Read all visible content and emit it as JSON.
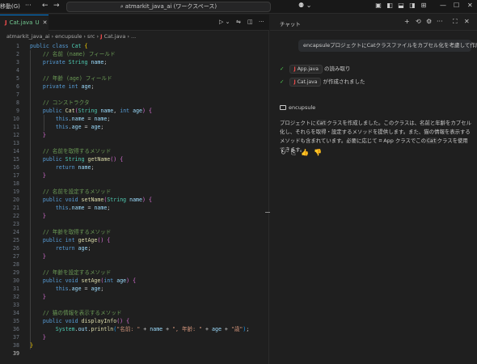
{
  "titlebar": {
    "menu_label": "移動(G)",
    "more": "···",
    "back": "←",
    "forward": "→",
    "search_text": "atmarkit_java_ai (ワークスペース)",
    "copilot_label": "⚉ ⌄",
    "layout_icons": [
      "▣",
      "◧",
      "⬓",
      "◨",
      "⊞"
    ],
    "window_controls": [
      "—",
      "☐",
      "✕"
    ]
  },
  "editor": {
    "tab": {
      "icon": "J",
      "name": "Cat.java",
      "status": "U",
      "close": "✕"
    },
    "actions": [
      "▷ ⌄",
      "⇋",
      "◫",
      "···"
    ],
    "breadcrumb": [
      "atmarkit_java_ai",
      "encupsule",
      "src",
      "J",
      "Cat.java",
      "..."
    ],
    "lines": [
      [
        {
          "t": "public class ",
          "c": "kw"
        },
        {
          "t": "Cat",
          "c": "ty"
        },
        {
          "t": " {",
          "c": "br1"
        }
      ],
      [
        {
          "t": "    // 名前 (name) フィールド",
          "c": "cm"
        }
      ],
      [
        {
          "t": "    private ",
          "c": "kw"
        },
        {
          "t": "String",
          "c": "ty"
        },
        {
          "t": " name",
          "c": "va"
        },
        {
          "t": ";",
          "c": ""
        }
      ],
      [],
      [
        {
          "t": "    // 年齢 (age) フィールド",
          "c": "cm"
        }
      ],
      [
        {
          "t": "    private int ",
          "c": "kw"
        },
        {
          "t": "age",
          "c": "va"
        },
        {
          "t": ";",
          "c": ""
        }
      ],
      [],
      [
        {
          "t": "    // コンストラクタ",
          "c": "cm"
        }
      ],
      [
        {
          "t": "    public ",
          "c": "kw"
        },
        {
          "t": "Cat",
          "c": "fn"
        },
        {
          "t": "(",
          "c": "br2"
        },
        {
          "t": "String",
          "c": "ty"
        },
        {
          "t": " name",
          "c": "va"
        },
        {
          "t": ", ",
          "c": ""
        },
        {
          "t": "int",
          "c": "kw"
        },
        {
          "t": " age",
          "c": "va"
        },
        {
          "t": ")",
          "c": "br2"
        },
        {
          "t": " {",
          "c": "br2"
        }
      ],
      [
        {
          "t": "        this",
          "c": "kw"
        },
        {
          "t": ".",
          "c": ""
        },
        {
          "t": "name",
          "c": "va"
        },
        {
          "t": " = ",
          "c": ""
        },
        {
          "t": "name",
          "c": "va"
        },
        {
          "t": ";",
          "c": ""
        }
      ],
      [
        {
          "t": "        this",
          "c": "kw"
        },
        {
          "t": ".",
          "c": ""
        },
        {
          "t": "age",
          "c": "va"
        },
        {
          "t": " = ",
          "c": ""
        },
        {
          "t": "age",
          "c": "va"
        },
        {
          "t": ";",
          "c": ""
        }
      ],
      [
        {
          "t": "    }",
          "c": "br2"
        }
      ],
      [],
      [
        {
          "t": "    // 名前を取得するメソッド",
          "c": "cm"
        }
      ],
      [
        {
          "t": "    public ",
          "c": "kw"
        },
        {
          "t": "String ",
          "c": "ty"
        },
        {
          "t": "getName",
          "c": "fn"
        },
        {
          "t": "()",
          "c": "br2"
        },
        {
          "t": " {",
          "c": "br2"
        }
      ],
      [
        {
          "t": "        return ",
          "c": "kw"
        },
        {
          "t": "name",
          "c": "va"
        },
        {
          "t": ";",
          "c": ""
        }
      ],
      [
        {
          "t": "    }",
          "c": "br2"
        }
      ],
      [],
      [
        {
          "t": "    // 名前を設定するメソッド",
          "c": "cm"
        }
      ],
      [
        {
          "t": "    public void ",
          "c": "kw"
        },
        {
          "t": "setName",
          "c": "fn"
        },
        {
          "t": "(",
          "c": "br2"
        },
        {
          "t": "String",
          "c": "ty"
        },
        {
          "t": " name",
          "c": "va"
        },
        {
          "t": ")",
          "c": "br2"
        },
        {
          "t": " {",
          "c": "br2"
        }
      ],
      [
        {
          "t": "        this",
          "c": "kw"
        },
        {
          "t": ".",
          "c": ""
        },
        {
          "t": "name",
          "c": "va"
        },
        {
          "t": " = ",
          "c": ""
        },
        {
          "t": "name",
          "c": "va"
        },
        {
          "t": ";",
          "c": ""
        }
      ],
      [
        {
          "t": "    }",
          "c": "br2"
        }
      ],
      [],
      [
        {
          "t": "    // 年齢を取得するメソッド",
          "c": "cm"
        }
      ],
      [
        {
          "t": "    public int ",
          "c": "kw"
        },
        {
          "t": "getAge",
          "c": "fn"
        },
        {
          "t": "()",
          "c": "br2"
        },
        {
          "t": " {",
          "c": "br2"
        }
      ],
      [
        {
          "t": "        return ",
          "c": "kw"
        },
        {
          "t": "age",
          "c": "va"
        },
        {
          "t": ";",
          "c": ""
        }
      ],
      [
        {
          "t": "    }",
          "c": "br2"
        }
      ],
      [],
      [
        {
          "t": "    // 年齢を設定するメソッド",
          "c": "cm"
        }
      ],
      [
        {
          "t": "    public void ",
          "c": "kw"
        },
        {
          "t": "setAge",
          "c": "fn"
        },
        {
          "t": "(",
          "c": "br2"
        },
        {
          "t": "int",
          "c": "kw"
        },
        {
          "t": " age",
          "c": "va"
        },
        {
          "t": ")",
          "c": "br2"
        },
        {
          "t": " {",
          "c": "br2"
        }
      ],
      [
        {
          "t": "        this",
          "c": "kw"
        },
        {
          "t": ".",
          "c": ""
        },
        {
          "t": "age",
          "c": "va"
        },
        {
          "t": " = ",
          "c": ""
        },
        {
          "t": "age",
          "c": "va"
        },
        {
          "t": ";",
          "c": ""
        }
      ],
      [
        {
          "t": "    }",
          "c": "br2"
        }
      ],
      [],
      [
        {
          "t": "    // 猫の情報を表示するメソッド",
          "c": "cm"
        }
      ],
      [
        {
          "t": "    public void ",
          "c": "kw"
        },
        {
          "t": "displayInfo",
          "c": "fn"
        },
        {
          "t": "()",
          "c": "br2"
        },
        {
          "t": " {",
          "c": "br2"
        }
      ],
      [
        {
          "t": "        System",
          "c": "ty"
        },
        {
          "t": ".",
          "c": ""
        },
        {
          "t": "out",
          "c": "va"
        },
        {
          "t": ".",
          "c": ""
        },
        {
          "t": "println",
          "c": "fn"
        },
        {
          "t": "(",
          "c": "br3"
        },
        {
          "t": "\"名前: \"",
          "c": "st"
        },
        {
          "t": " + ",
          "c": ""
        },
        {
          "t": "name",
          "c": "va"
        },
        {
          "t": " + ",
          "c": ""
        },
        {
          "t": "\", 年齢: \"",
          "c": "st"
        },
        {
          "t": " + ",
          "c": ""
        },
        {
          "t": "age",
          "c": "va"
        },
        {
          "t": " + ",
          "c": ""
        },
        {
          "t": "\"歳\"",
          "c": "st"
        },
        {
          "t": ")",
          "c": "br3"
        },
        {
          "t": ";",
          "c": ""
        }
      ],
      [
        {
          "t": "    }",
          "c": "br2"
        }
      ],
      [
        {
          "t": "}",
          "c": "br1"
        }
      ],
      []
    ],
    "active_line": 39
  },
  "chat": {
    "title": "チャット",
    "header_icons": [
      "+",
      "⟲",
      "⚙",
      "···",
      "⛶",
      "✕"
    ],
    "user_message": "encapsuleプロジェクトにCatクラスファイルをカプセル化を考慮して作成して。",
    "steps": [
      {
        "file": "App.java",
        "text": "の読み取り"
      },
      {
        "file": "Cat.java",
        "text": "が作成されました"
      }
    ],
    "folder": "encupsule",
    "answer": {
      "p1": "プロジェクトに",
      "code1": "Cat",
      "p2": "クラスを作成しました。このクラスは、名前と年齢をカプセル化し、それらを取得・設定するメソッドを提供します。また、猫の情報を表示するメソッドも含まれています。必要に応じて ",
      "app_icon": "⌗",
      "app": "App",
      "p3": " クラスでこの",
      "code2": "Cat",
      "p4": "クラスを使用できます。"
    },
    "feedback": [
      "↻",
      "⎘",
      "👍",
      "👎"
    ]
  }
}
